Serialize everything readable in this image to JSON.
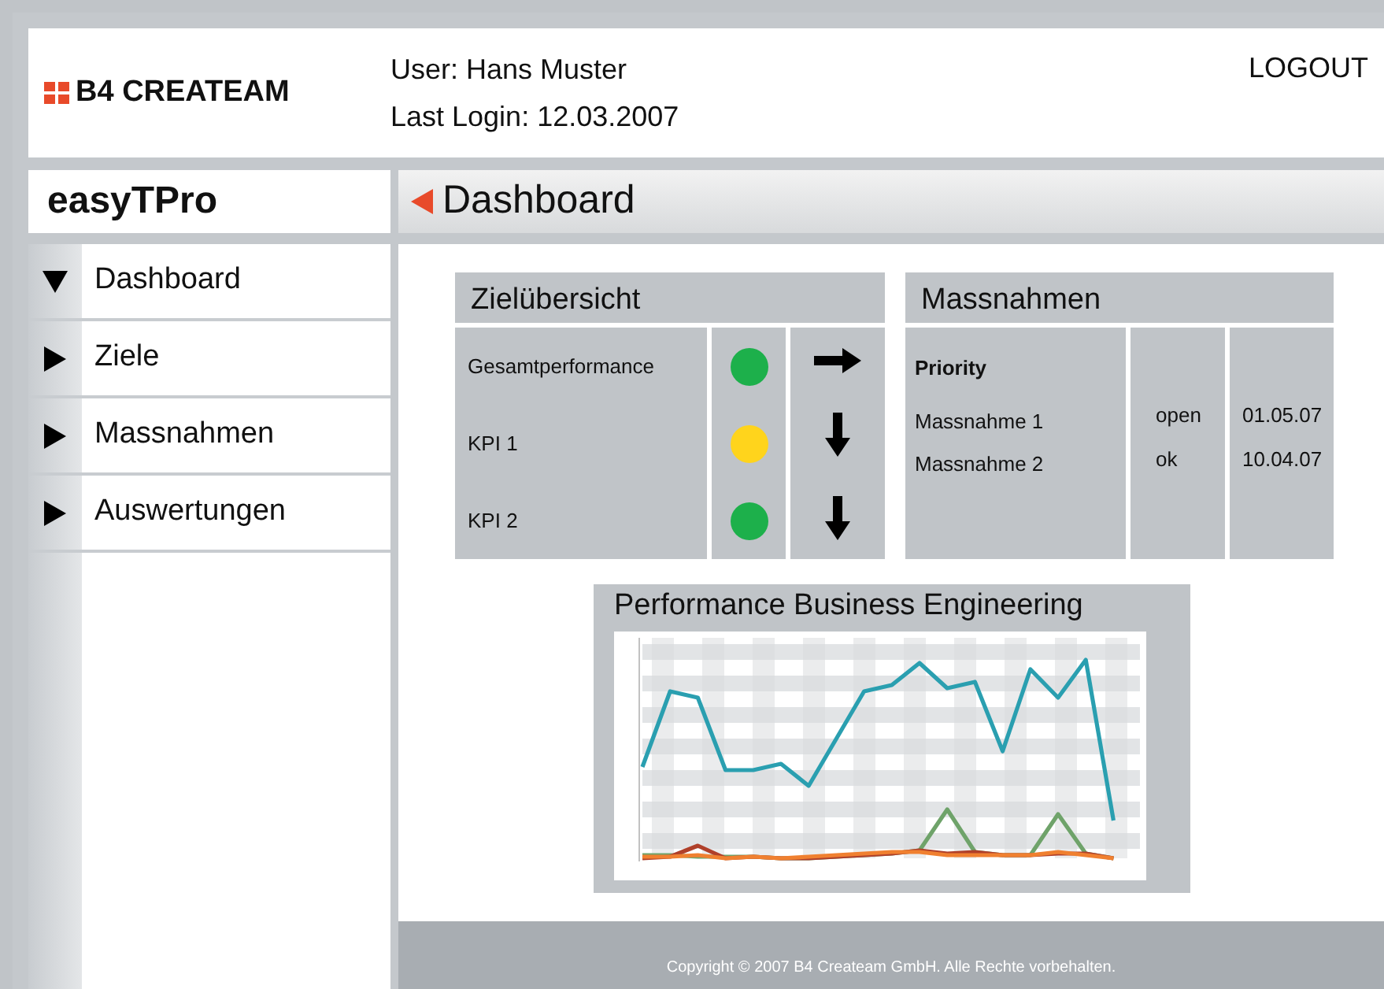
{
  "header": {
    "logo": "B4 CREATEAM",
    "user": "User: Hans Muster",
    "last_login": "Last Login: 12.03.2007",
    "logout": "LOGOUT"
  },
  "app_title": "easyTPro",
  "page_title": "Dashboard",
  "sidebar": {
    "items": [
      {
        "label": "Dashboard",
        "expanded": true
      },
      {
        "label": "Ziele",
        "expanded": false
      },
      {
        "label": "Massnahmen",
        "expanded": false
      },
      {
        "label": "Auswertungen",
        "expanded": false
      }
    ]
  },
  "goals": {
    "title": "Zielübersicht",
    "rows": [
      {
        "label": "Gesamtperformance",
        "color": "#1db04b",
        "kind": "right"
      },
      {
        "label": "KPI 1",
        "color": "#ffd41c",
        "kind": "down"
      },
      {
        "label": "KPI 2",
        "color": "#1db04b",
        "kind": "down"
      }
    ]
  },
  "measures": {
    "title": "Massnahmen",
    "header": "Priority",
    "rows": [
      {
        "name": "Massnahme 1",
        "status": "open",
        "date": "01.05.07"
      },
      {
        "name": "Massnahme 2",
        "status": "ok",
        "date": "10.04.07"
      }
    ]
  },
  "chart": {
    "title": "Performance Business Engineering"
  },
  "footer": "Copyright © 2007 B4 Createam GmbH. Alle Rechte vorbehalten."
}
